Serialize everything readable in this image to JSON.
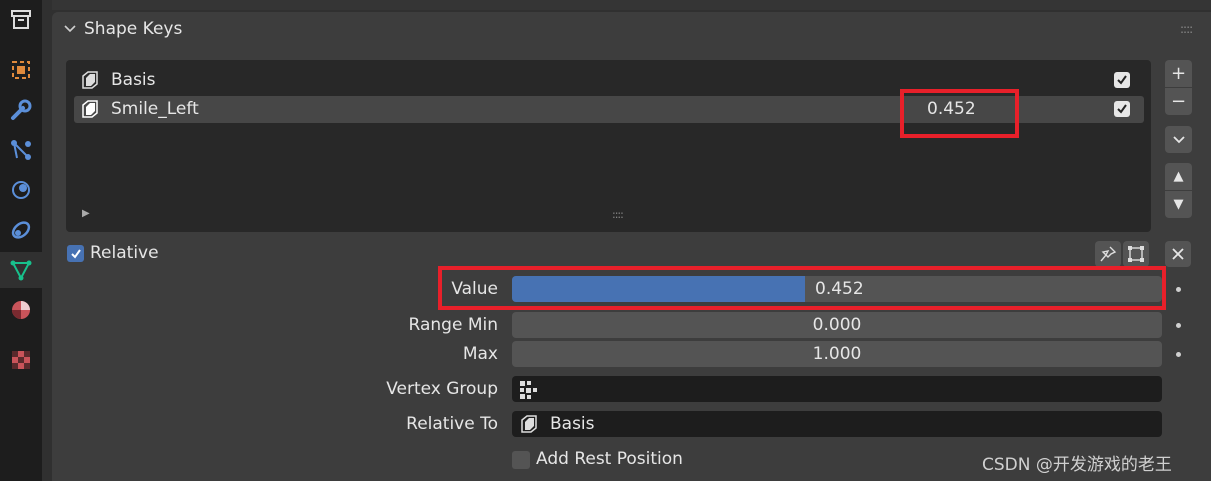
{
  "sidebar": {
    "tabs": [
      {
        "icon": "render-archive-icon",
        "name": "Archive"
      },
      {
        "icon": "object-icon",
        "name": "Object"
      },
      {
        "icon": "wrench-modifier-icon",
        "name": "Modifiers"
      },
      {
        "icon": "particles-icon",
        "name": "Particles"
      },
      {
        "icon": "physics-icon",
        "name": "Physics"
      },
      {
        "icon": "constraints-icon",
        "name": "Constraints"
      },
      {
        "icon": "mesh-data-icon",
        "name": "Data"
      },
      {
        "icon": "material-icon",
        "name": "Material"
      },
      {
        "icon": "texture-icon",
        "name": "Texture"
      }
    ],
    "active_tab": "mesh-data-icon",
    "active_color": "#18c08c"
  },
  "panel": {
    "title": "Shape Keys",
    "grip": "::::"
  },
  "shape_keys": {
    "items": [
      {
        "name": "Basis",
        "value": "",
        "enabled": true,
        "selected": false
      },
      {
        "name": "Smile_Left",
        "value": "0.452",
        "enabled": true,
        "selected": true
      }
    ],
    "list_grip": "::::"
  },
  "side_buttons": {
    "add": "+",
    "remove": "−",
    "menu": "⌄",
    "move_up": "▲",
    "move_down": "▼"
  },
  "relative": {
    "label": "Relative",
    "checked": true
  },
  "properties": {
    "value_label": "Value",
    "value": "0.452",
    "value_fraction": 0.452,
    "range_min_label": "Range Min",
    "range_min": "0.000",
    "max_label": "Max",
    "max": "1.000",
    "vertex_group_label": "Vertex Group",
    "vertex_group": "",
    "relative_to_label": "Relative To",
    "relative_to": "Basis",
    "add_rest_label": "Add Rest Position",
    "add_rest_checked": false
  },
  "watermark": "CSDN @开发游戏的老王",
  "colors": {
    "accent": "#4772b3",
    "highlight_box": "#e8202a",
    "panel_bg": "#3d3d3d",
    "list_bg": "#282828"
  }
}
